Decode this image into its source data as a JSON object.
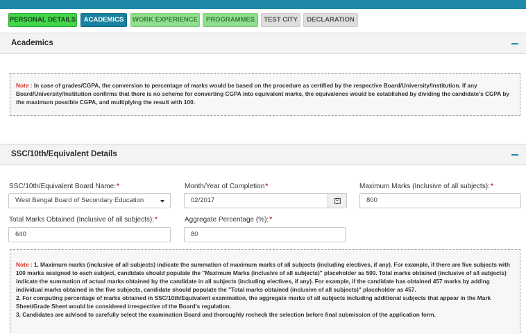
{
  "tabs": [
    "PERSONAL DETAILS",
    "ACADEMICS",
    "WORK EXPERIENCE",
    "PROGRAMMES",
    "TEST CITY",
    "DECLARATION"
  ],
  "academics": {
    "title": "Academics",
    "note_label": "Note :",
    "note_text": "In case of grades/CGPA, the conversion to percentage of marks would be based on the procedure as certified by the respective Board/University/Institution. If any Board/University/Institution confirms that there is no scheme for converting CGPA into equivalent marks, the equivalence would be established by dividing the candidate's CGPA by the maximum possible CGPA, and multiplying the result with 100."
  },
  "ssc": {
    "title": "SSC/10th/Equivalent Details",
    "board_label": "SSC/10th/Equivalent Board Name:",
    "board_value": "West Bengal Board of Secondary Education",
    "month_label": "Month/Year of Completion",
    "month_value": "02/2017",
    "max_label": "Maximum Marks (Inclusive of all subjects):",
    "max_value": "800",
    "total_label": "Total Marks Obtained (Inclusive of all subjects):",
    "total_value": "640",
    "agg_label": "Aggregate Percentage (%):",
    "agg_value": "80",
    "required_mark": "*",
    "note_label": "Note :",
    "note_p1": "1. Maximum marks (inclusive of all subjects) indicate the summation of maximum marks of all subjects (including electives, if any). For example, if there are five subjects with 100 marks assigned to each subject, candidate should populate the \"Maximum Marks (inclusive of all subjects)\" placeholder as 500. Total marks obtained (inclusive of all subjects) indicate the summation of actual marks obtained by the candidate in all subjects (including electives, if any). For example, if the candidate has obtained 457 marks by adding individual marks obtained in the five subjects, candidate should populate the \"Total marks obtained (inclusive of all subjects)\" placeholder as 457.",
    "note_p2": "2. For computing percentage of marks obtained in SSC/10th/Equivalent examination, the aggregate marks of all subjects including additional subjects that appear in the Mark Sheet/Grade Sheet would be considered irrespective of the Board's regulation.",
    "note_p3": "3. Candidates are advised to carefully select the examination Board and thoroughly recheck the selection before final submission of the application form."
  }
}
